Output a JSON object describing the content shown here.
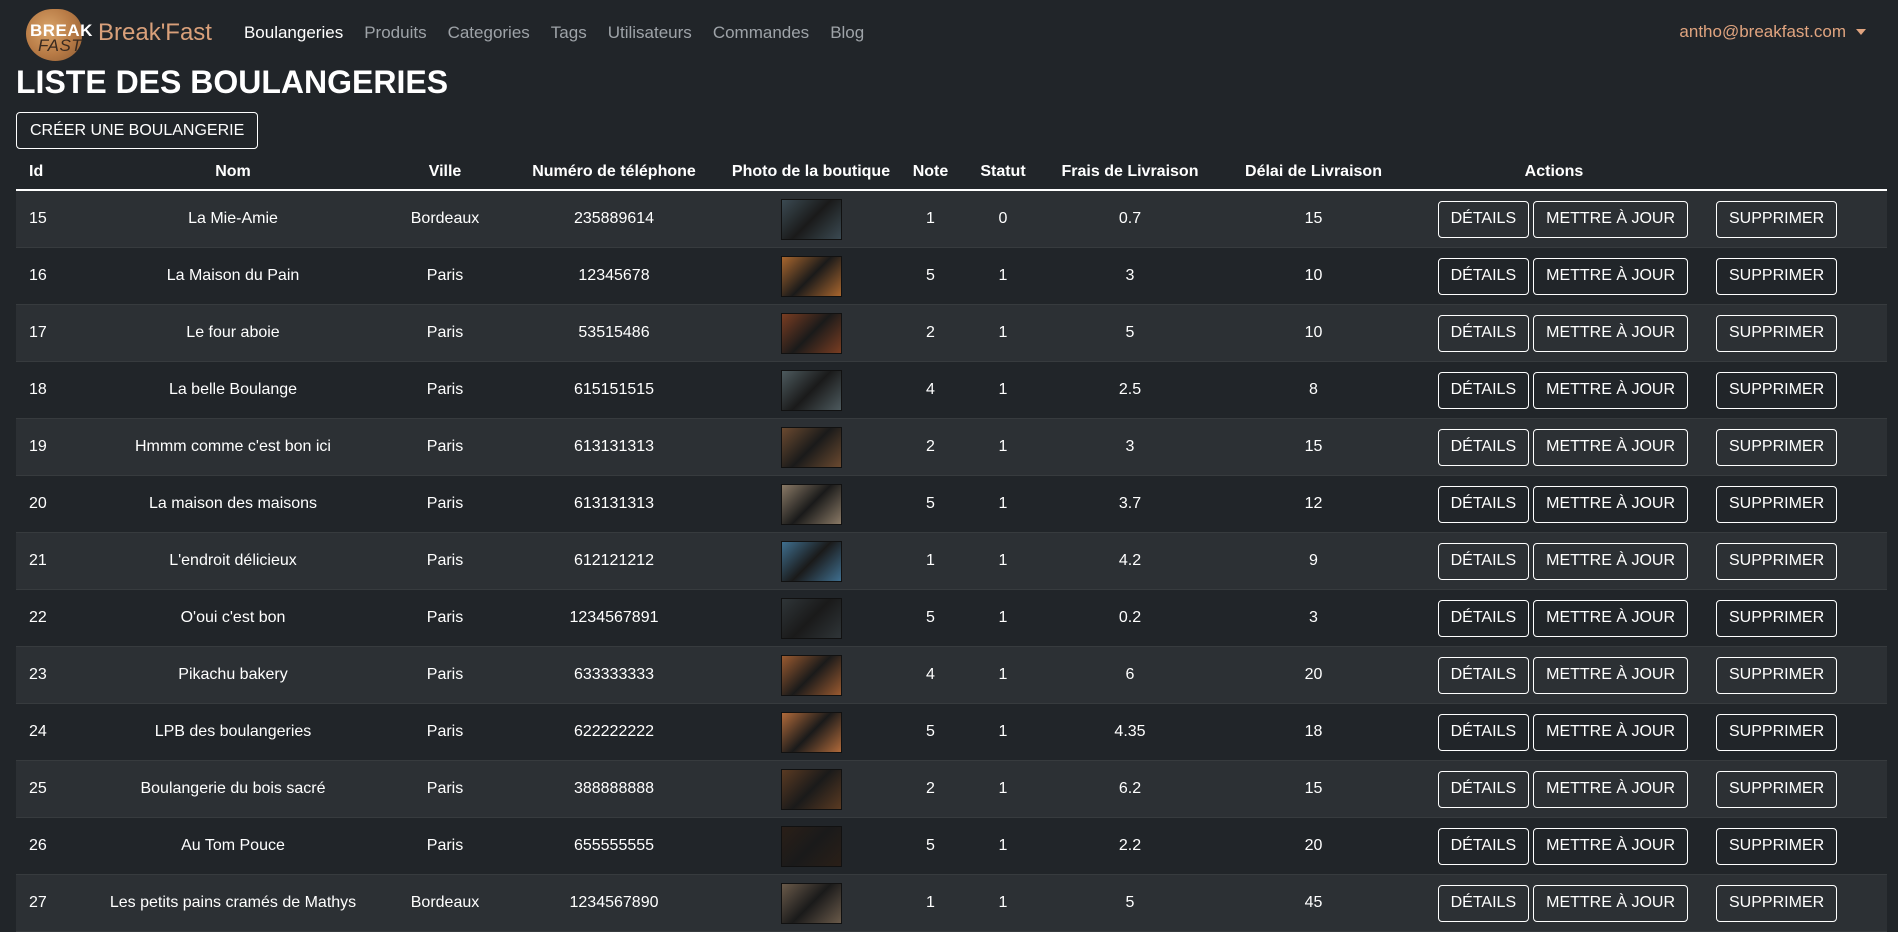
{
  "navbar": {
    "logo_word1": "BREAK",
    "logo_word2": "FAST",
    "brand": "Break'Fast",
    "links": [
      "Boulangeries",
      "Produits",
      "Categories",
      "Tags",
      "Utilisateurs",
      "Commandes",
      "Blog"
    ],
    "active_link": "Boulangeries",
    "user_email": "antho@breakfast.com"
  },
  "page": {
    "title": "LISTE DES BOULANGERIES",
    "create_button": "CRÉER UNE BOULANGERIE"
  },
  "table": {
    "headers": {
      "id": "Id",
      "nom": "Nom",
      "ville": "Ville",
      "telephone": "Numéro de téléphone",
      "photo": "Photo de la boutique",
      "note": "Note",
      "statut": "Statut",
      "frais": "Frais de Livraison",
      "delai": "Délai de Livraison",
      "actions": "Actions"
    },
    "action_labels": {
      "details": "DÉTAILS",
      "update": "METTRE À JOUR",
      "delete": "SUPPRIMER"
    },
    "rows": [
      {
        "id": "15",
        "nom": "La Mie-Amie",
        "ville": "Bordeaux",
        "telephone": "235889614",
        "note": "1",
        "statut": "0",
        "frais": "0.7",
        "delai": "15"
      },
      {
        "id": "16",
        "nom": "La Maison du Pain",
        "ville": "Paris",
        "telephone": "12345678",
        "note": "5",
        "statut": "1",
        "frais": "3",
        "delai": "10"
      },
      {
        "id": "17",
        "nom": "Le four aboie",
        "ville": "Paris",
        "telephone": "53515486",
        "note": "2",
        "statut": "1",
        "frais": "5",
        "delai": "10"
      },
      {
        "id": "18",
        "nom": "La belle Boulange",
        "ville": "Paris",
        "telephone": "615151515",
        "note": "4",
        "statut": "1",
        "frais": "2.5",
        "delai": "8"
      },
      {
        "id": "19",
        "nom": "Hmmm comme c'est bon ici",
        "ville": "Paris",
        "telephone": "613131313",
        "note": "2",
        "statut": "1",
        "frais": "3",
        "delai": "15"
      },
      {
        "id": "20",
        "nom": "La maison des maisons",
        "ville": "Paris",
        "telephone": "613131313",
        "note": "5",
        "statut": "1",
        "frais": "3.7",
        "delai": "12"
      },
      {
        "id": "21",
        "nom": "L'endroit délicieux",
        "ville": "Paris",
        "telephone": "612121212",
        "note": "1",
        "statut": "1",
        "frais": "4.2",
        "delai": "9"
      },
      {
        "id": "22",
        "nom": "O'oui c'est bon",
        "ville": "Paris",
        "telephone": "1234567891",
        "note": "5",
        "statut": "1",
        "frais": "0.2",
        "delai": "3"
      },
      {
        "id": "23",
        "nom": "Pikachu bakery",
        "ville": "Paris",
        "telephone": "633333333",
        "note": "4",
        "statut": "1",
        "frais": "6",
        "delai": "20"
      },
      {
        "id": "24",
        "nom": "LPB des boulangeries",
        "ville": "Paris",
        "telephone": "622222222",
        "note": "5",
        "statut": "1",
        "frais": "4.35",
        "delai": "18"
      },
      {
        "id": "25",
        "nom": "Boulangerie du bois sacré",
        "ville": "Paris",
        "telephone": "388888888",
        "note": "2",
        "statut": "1",
        "frais": "6.2",
        "delai": "15"
      },
      {
        "id": "26",
        "nom": "Au Tom Pouce",
        "ville": "Paris",
        "telephone": "655555555",
        "note": "5",
        "statut": "1",
        "frais": "2.2",
        "delai": "20"
      },
      {
        "id": "27",
        "nom": "Les petits pains cramés de Mathys",
        "ville": "Bordeaux",
        "telephone": "1234567890",
        "note": "1",
        "statut": "1",
        "frais": "5",
        "delai": "45"
      }
    ]
  },
  "colors": {
    "background": "#212529",
    "row_striped": "#2c3034",
    "brand_accent": "#d9a07a",
    "nav_muted": "#9ea3a8",
    "photo_tones": [
      "#3b4a52",
      "#a8662e",
      "#7a3d22",
      "#4d5a5e",
      "#6b4a30",
      "#8a7a66",
      "#3f6f8f",
      "#2f3538",
      "#9a5a30",
      "#b06a3a",
      "#5a3a22",
      "#2a1f18",
      "#6a5a4a"
    ]
  }
}
